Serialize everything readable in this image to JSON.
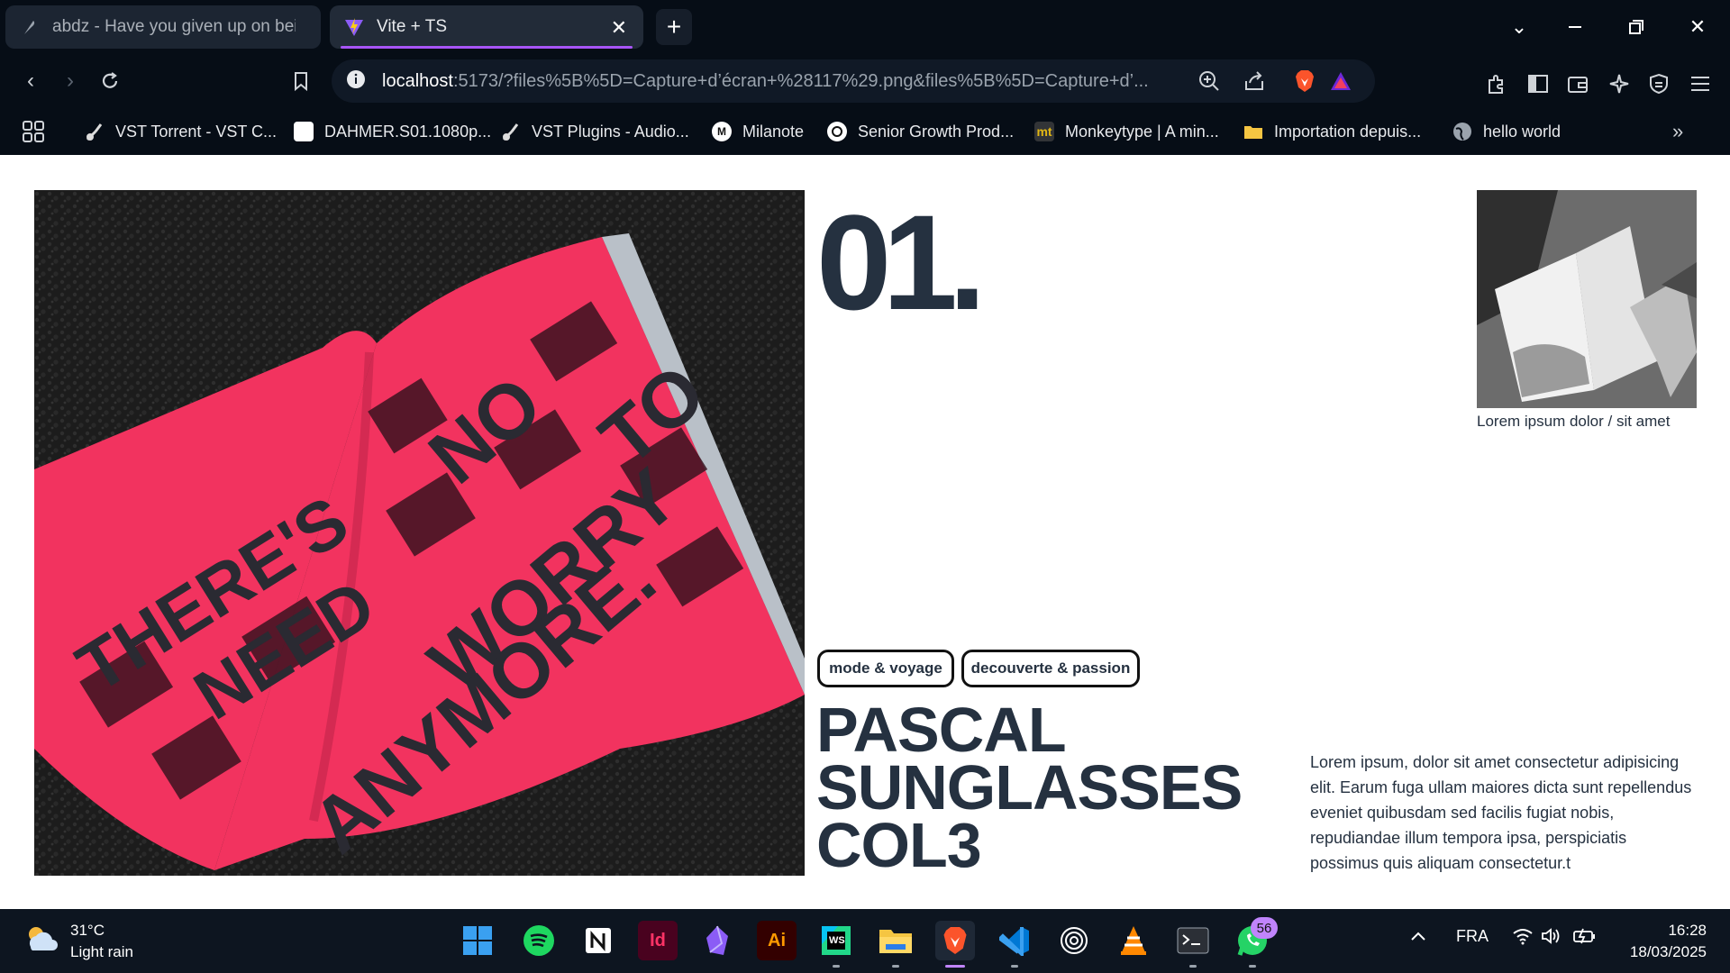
{
  "tabs": [
    {
      "title": "abdz - Have you given up on being",
      "active": false
    },
    {
      "title": "Vite + TS",
      "active": true
    }
  ],
  "address": {
    "host": "localhost",
    "rest": ":5173/?files%5B%5D=Capture+d’écran+%28117%29.png&files%5B%5D=Capture+d’..."
  },
  "bookmarks": [
    {
      "label": "VST Torrent - VST C...",
      "icon": "guitar-icon"
    },
    {
      "label": "DAHMER.S01.1080p...",
      "icon": "blank-page-icon"
    },
    {
      "label": "VST Plugins - Audio...",
      "icon": "guitar-icon"
    },
    {
      "label": "Milanote",
      "icon": "milanote-icon"
    },
    {
      "label": "Senior Growth Prod...",
      "icon": "circle-logo-icon"
    },
    {
      "label": "Monkeytype | A min...",
      "icon": "monkeytype-icon"
    },
    {
      "label": "Importation depuis...",
      "icon": "folder-icon"
    },
    {
      "label": "hello world",
      "icon": "globe-icon"
    }
  ],
  "page": {
    "number": "01.",
    "thumb_caption": "Lorem ipsum dolor / sit amet",
    "tags": [
      "mode & voyage",
      "decouverte & passion"
    ],
    "title_lines": [
      "PASCAL",
      "SUNGLASSES",
      "COL3"
    ],
    "description": "Lorem ipsum, dolor sit amet consectetur adipisicing elit. Earum fuga ullam maiores dicta sunt repellendus eveniet quibusdam sed facilis fugiat nobis, repudiandae illum tempora ipsa, perspiciatis possimus quis aliquam consectetur.t",
    "hero_spread_text": [
      "THERE'S",
      "NEED",
      "NO",
      "TO",
      "WORRY",
      "ANYMORE."
    ]
  },
  "taskbar": {
    "temperature": "31°C",
    "weather": "Light rain",
    "language": "FRA",
    "time": "16:28",
    "date": "18/03/2025",
    "whatsapp_badge": "56",
    "app_labels": {
      "indesign": "Id",
      "illustrator": "Ai",
      "webstorm": "WS",
      "monkeytype": "mt"
    }
  },
  "colors": {
    "chrome_bg": "#060d16",
    "accent_tab": "#a855f7",
    "ink": "#253140",
    "magazine_pink": "#f2335f",
    "taskbar_bg": "#0d1520"
  }
}
